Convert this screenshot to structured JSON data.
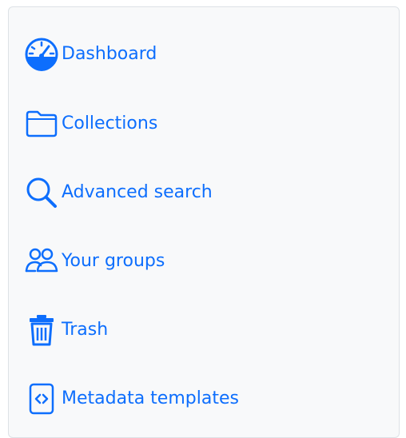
{
  "sidebar": {
    "items": [
      {
        "label": "Dashboard",
        "icon": "dashboard-icon"
      },
      {
        "label": "Collections",
        "icon": "folder-icon"
      },
      {
        "label": "Advanced search",
        "icon": "search-icon"
      },
      {
        "label": "Your groups",
        "icon": "people-icon"
      },
      {
        "label": "Trash",
        "icon": "trash-icon"
      },
      {
        "label": "Metadata templates",
        "icon": "code-file-icon"
      }
    ]
  },
  "colors": {
    "link": "#0d6efd",
    "panel_background": "#f8f9fa",
    "panel_border": "#dde2e6"
  }
}
